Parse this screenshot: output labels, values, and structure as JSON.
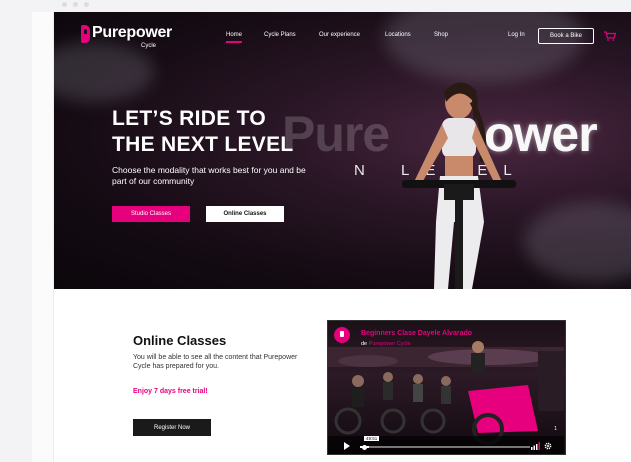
{
  "nav": {
    "logo_text": "Purepower",
    "logo_sub": "Cycle",
    "links": [
      "Home",
      "Cycle Plans",
      "Our experience",
      "Locations",
      "Shop"
    ],
    "login": "Log In",
    "book_button": "Book a Bike"
  },
  "hero": {
    "title_line1": "LET’S RIDE TO",
    "title_line2": "THE NEXT LEVEL",
    "subtitle": "Choose the modality that works best for you and be part of our community",
    "studio_button": "Studio Classes",
    "online_button": "Online Classes",
    "bg_brand_dim": "Pure",
    "bg_brand_bright": "ower",
    "bg_tagline": "N  LEVEL"
  },
  "online": {
    "title": "Online Classes",
    "description": "You will be able to see all the content that Purepower Cycle has prepared for you.",
    "trial": "Enjoy 7 days free trial!",
    "register_button": "Register Now"
  },
  "video": {
    "title": "Beginners Clase Dayele Alvarado",
    "channel_prefix": "de",
    "channel": "Purepower Cycle",
    "time": "49:51",
    "progress": 0.05,
    "counter": "1"
  },
  "colors": {
    "accent": "#e6007e",
    "hero_bg": "#140b13"
  }
}
